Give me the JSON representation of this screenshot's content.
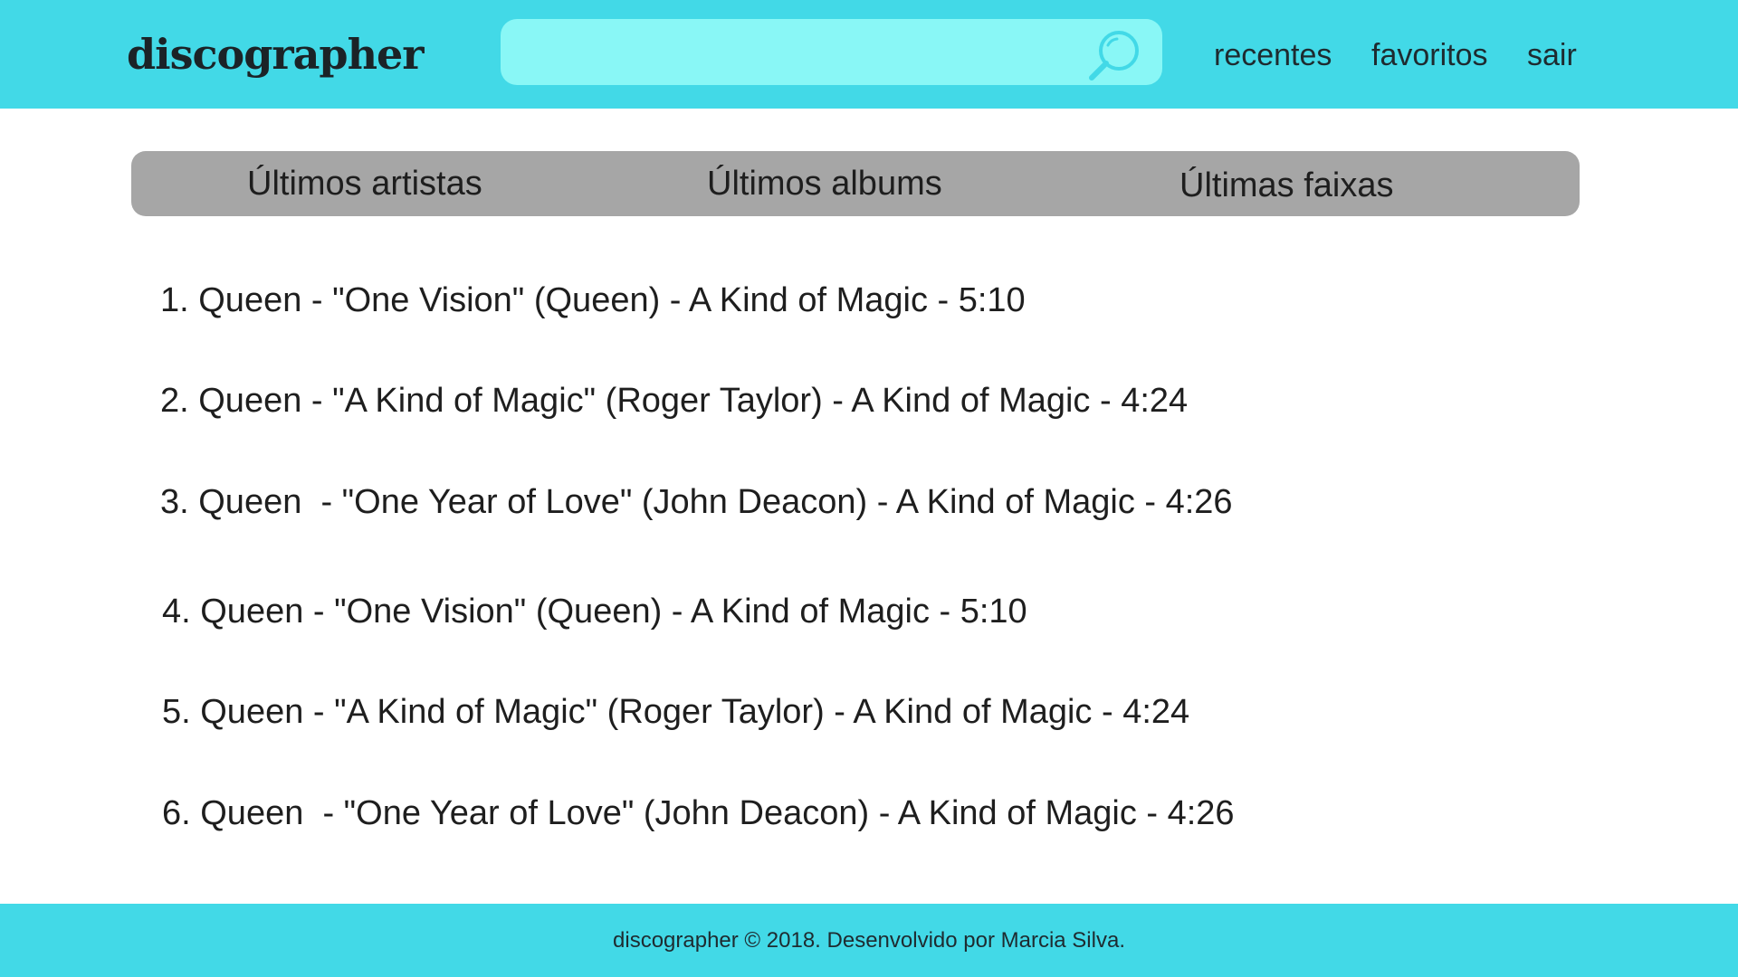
{
  "header": {
    "logo": "discographer",
    "search": {
      "value": "",
      "placeholder": ""
    },
    "nav": {
      "recentes": "recentes",
      "favoritos": "favoritos",
      "sair": "sair"
    }
  },
  "tabs": [
    {
      "label": "Últimos artistas"
    },
    {
      "label": "Últimos albums"
    },
    {
      "label": "Últimas faixas"
    }
  ],
  "tracks": [
    {
      "text": "1. Queen - \"One Vision\" (Queen) - A Kind of Magic - 5:10"
    },
    {
      "text": "2. Queen - \"A Kind of Magic\" (Roger Taylor) - A Kind of Magic - 4:24"
    },
    {
      "text": "3. Queen  - \"One Year of Love\" (John Deacon) - A Kind of Magic - 4:26"
    },
    {
      "text": "4. Queen - \"One Vision\" (Queen) - A Kind of Magic - 5:10"
    },
    {
      "text": "5. Queen - \"A Kind of Magic\" (Roger Taylor) - A Kind of Magic - 4:24"
    },
    {
      "text": "6. Queen  - \"One Year of Love\" (John Deacon) - A Kind of Magic - 4:26"
    }
  ],
  "footer": {
    "text": "discographer © 2018. Desenvolvido por Marcia Silva."
  },
  "colors": {
    "header_bg": "#42d9e7",
    "search_bg": "#89f7f6",
    "search_icon": "#42d9e7",
    "tabs_bg": "#a6a6a6",
    "footer_bg": "#42d9e7"
  },
  "icons": {
    "search": "search-icon"
  }
}
